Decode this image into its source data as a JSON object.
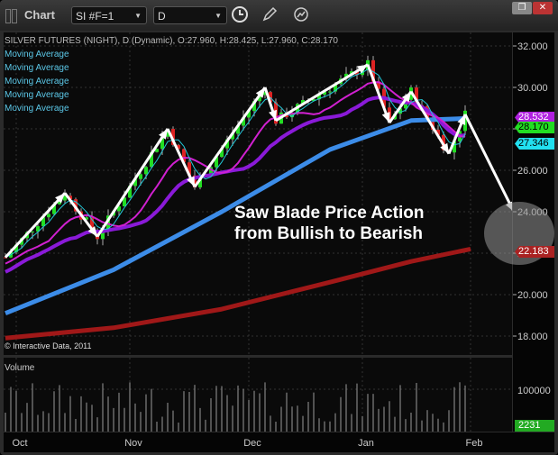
{
  "window": {
    "title": "Chart",
    "symbol": "SI #F=1",
    "interval": "D",
    "icons": [
      "clock-icon",
      "pencil-icon",
      "indicator-icon",
      "restore-icon",
      "close-icon"
    ]
  },
  "header": {
    "info": "SILVER FUTURES (NIGHT), D (Dynamic), O:27.960, H:28.425, L:27.960, C:28.170",
    "studies": [
      "Moving Average",
      "Moving Average",
      "Moving Average",
      "Moving Average",
      "Moving Average"
    ],
    "copyright": "© Interactive Data, 2011"
  },
  "annotation": {
    "line1": "Saw Blade Price Action",
    "line2": "from Bullish to Bearish"
  },
  "volume": {
    "label": "Volume",
    "tick": "100000",
    "last": "2231",
    "last_color": "#22aa22"
  },
  "chart_data": {
    "type": "candlestick",
    "title": "SILVER FUTURES (NIGHT)",
    "y_ticks": [
      "32.000",
      "30.000",
      "28.000",
      "26.000",
      "24.000",
      "22.000",
      "20.000",
      "18.000"
    ],
    "ylim": [
      17.4,
      32.6
    ],
    "x_ticks": [
      "Oct",
      "Nov",
      "Dec",
      "Jan",
      "Feb"
    ],
    "x_tick_index": [
      2,
      23,
      45,
      66,
      86
    ],
    "swing_points": [
      [
        0,
        21.8
      ],
      [
        11,
        24.9
      ],
      [
        17,
        22.8
      ],
      [
        30,
        28.0
      ],
      [
        35,
        25.2
      ],
      [
        48,
        30.0
      ],
      [
        50,
        28.4
      ],
      [
        67,
        31.1
      ],
      [
        71,
        28.3
      ],
      [
        75,
        29.8
      ],
      [
        82,
        26.8
      ],
      [
        85,
        28.7
      ],
      [
        94,
        24.0
      ]
    ],
    "ma_blue": [
      [
        0,
        19.1
      ],
      [
        20,
        21.2
      ],
      [
        40,
        24.0
      ],
      [
        60,
        27.0
      ],
      [
        75,
        28.4
      ],
      [
        85,
        28.5
      ]
    ],
    "ma_red": [
      [
        0,
        17.9
      ],
      [
        20,
        18.4
      ],
      [
        40,
        19.3
      ],
      [
        60,
        20.6
      ],
      [
        75,
        21.6
      ],
      [
        86,
        22.2
      ]
    ],
    "price_labels": [
      {
        "value": "28.532",
        "color": "#b020e0"
      },
      {
        "value": "28.170",
        "color": "#22dd22"
      },
      {
        "value": "27.346",
        "color": "#22e0f0"
      },
      {
        "value": "22.183",
        "color": "#aa2222"
      }
    ]
  }
}
